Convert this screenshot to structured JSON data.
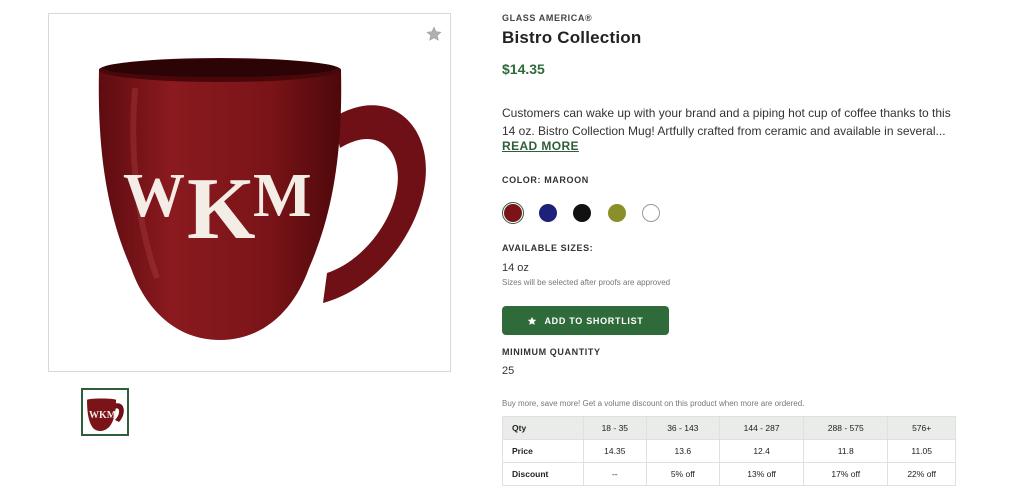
{
  "product": {
    "brand": "GLASS AMERICA®",
    "title": "Bistro Collection",
    "price": "$14.35",
    "description": "Customers can wake up with your brand and a piping hot cup of coffee thanks to this 14 oz. Bistro Collection Mug! Artfully crafted from ceramic and available in several...",
    "read_more": "READ MORE",
    "image_alt_monogram": "WKM"
  },
  "color": {
    "label": "COLOR: MAROON",
    "swatches": [
      {
        "name": "maroon",
        "hex": "#7a1418",
        "selected": true
      },
      {
        "name": "navy",
        "hex": "#1d2178"
      },
      {
        "name": "black",
        "hex": "#111111"
      },
      {
        "name": "olive",
        "hex": "#8a8f2a"
      },
      {
        "name": "white",
        "hex": "#ffffff"
      }
    ]
  },
  "sizes": {
    "label": "AVAILABLE SIZES:",
    "value": "14 oz",
    "note": "Sizes will be selected after proofs are approved"
  },
  "actions": {
    "add_to_shortlist": "ADD TO SHORTLIST"
  },
  "minimum": {
    "label": "MINIMUM QUANTITY",
    "value": "25"
  },
  "pricing": {
    "note": "Buy more, save more! Get a volume discount on this product when more are ordered.",
    "rows": [
      [
        "Qty",
        "18 - 35",
        "36 - 143",
        "144 - 287",
        "288 - 575",
        "576+"
      ],
      [
        "Price",
        "14.35",
        "13.6",
        "12.4",
        "11.8",
        "11.05"
      ],
      [
        "Discount",
        "--",
        "5% off",
        "13% off",
        "17% off",
        "22% off"
      ]
    ]
  },
  "colors": {
    "accent": "#2f6b3a",
    "mug": "#7a1418"
  }
}
